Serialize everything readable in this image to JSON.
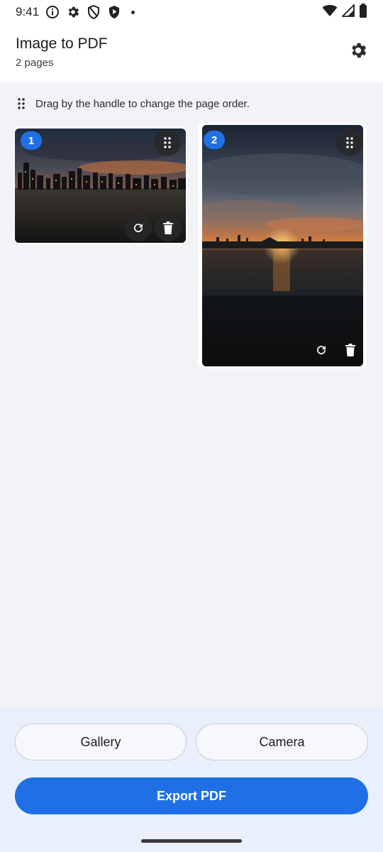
{
  "status_bar": {
    "time": "9:41",
    "icons": [
      "info-icon",
      "gear-icon",
      "shield-icon",
      "play-shield-icon",
      "dot-icon",
      "wifi-icon",
      "signal-icon",
      "battery-icon"
    ]
  },
  "header": {
    "title": "Image to PDF",
    "subtitle": "2 pages",
    "settings_icon": "gear-icon"
  },
  "hint": {
    "text": "Drag by the handle to change the page order.",
    "icon": "drag-handle-icon"
  },
  "pages": [
    {
      "number": "1",
      "orientation": "landscape",
      "scene": "city skyline at sunset"
    },
    {
      "number": "2",
      "orientation": "portrait",
      "scene": "sea sunset"
    }
  ],
  "actions": {
    "gallery_label": "Gallery",
    "camera_label": "Camera",
    "export_label": "Export PDF"
  },
  "colors": {
    "accent": "#1f6fe5",
    "background": "#f1f3f6",
    "bottom_panel": "#e9f0fb"
  }
}
